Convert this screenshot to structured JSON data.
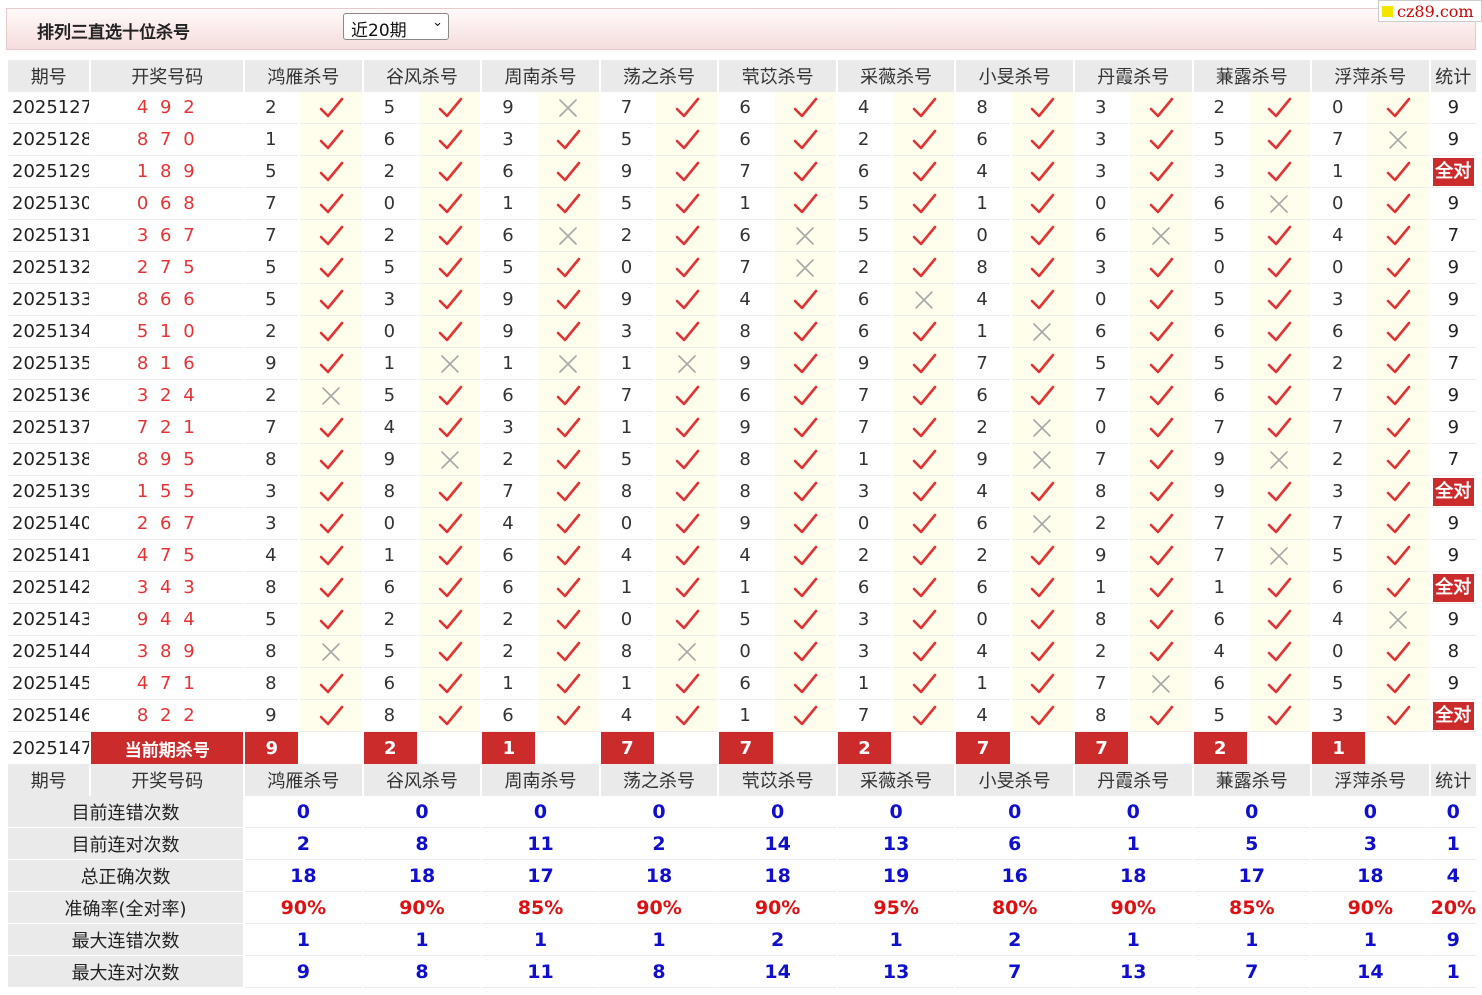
{
  "header": {
    "title": "排列三直选十位杀号",
    "period_select": "近20期",
    "logo_text": "cz89.com"
  },
  "columns": {
    "issue": "期号",
    "draw": "开奖号码",
    "experts": [
      "鸿雁杀号",
      "谷风杀号",
      "周南杀号",
      "荡之杀号",
      "茕苡杀号",
      "采薇杀号",
      "小旻杀号",
      "丹霞杀号",
      "蒹露杀号",
      "浮萍杀号"
    ],
    "stat": "统计"
  },
  "all_correct_label": "全对",
  "rows": [
    {
      "issue": "2025127",
      "draw": "4 9 2",
      "kills": [
        "2",
        "5",
        "9",
        "7",
        "6",
        "4",
        "8",
        "3",
        "2",
        "0"
      ],
      "ok": [
        1,
        1,
        0,
        1,
        1,
        1,
        1,
        1,
        1,
        1
      ],
      "stat": "9"
    },
    {
      "issue": "2025128",
      "draw": "8 7 0",
      "kills": [
        "1",
        "6",
        "3",
        "5",
        "6",
        "2",
        "6",
        "3",
        "5",
        "7"
      ],
      "ok": [
        1,
        1,
        1,
        1,
        1,
        1,
        1,
        1,
        1,
        0
      ],
      "stat": "9"
    },
    {
      "issue": "2025129",
      "draw": "1 8 9",
      "kills": [
        "5",
        "2",
        "6",
        "9",
        "7",
        "6",
        "4",
        "3",
        "3",
        "1"
      ],
      "ok": [
        1,
        1,
        1,
        1,
        1,
        1,
        1,
        1,
        1,
        1
      ],
      "stat": "全对"
    },
    {
      "issue": "2025130",
      "draw": "0 6 8",
      "kills": [
        "7",
        "0",
        "1",
        "5",
        "1",
        "5",
        "1",
        "0",
        "6",
        "0"
      ],
      "ok": [
        1,
        1,
        1,
        1,
        1,
        1,
        1,
        1,
        0,
        1
      ],
      "stat": "9"
    },
    {
      "issue": "2025131",
      "draw": "3 6 7",
      "kills": [
        "7",
        "2",
        "6",
        "2",
        "6",
        "5",
        "0",
        "6",
        "5",
        "4"
      ],
      "ok": [
        1,
        1,
        0,
        1,
        0,
        1,
        1,
        0,
        1,
        1
      ],
      "stat": "7"
    },
    {
      "issue": "2025132",
      "draw": "2 7 5",
      "kills": [
        "5",
        "5",
        "5",
        "0",
        "7",
        "2",
        "8",
        "3",
        "0",
        "0"
      ],
      "ok": [
        1,
        1,
        1,
        1,
        0,
        1,
        1,
        1,
        1,
        1
      ],
      "stat": "9"
    },
    {
      "issue": "2025133",
      "draw": "8 6 6",
      "kills": [
        "5",
        "3",
        "9",
        "9",
        "4",
        "6",
        "4",
        "0",
        "5",
        "3"
      ],
      "ok": [
        1,
        1,
        1,
        1,
        1,
        0,
        1,
        1,
        1,
        1
      ],
      "stat": "9"
    },
    {
      "issue": "2025134",
      "draw": "5 1 0",
      "kills": [
        "2",
        "0",
        "9",
        "3",
        "8",
        "6",
        "1",
        "6",
        "6",
        "6"
      ],
      "ok": [
        1,
        1,
        1,
        1,
        1,
        1,
        0,
        1,
        1,
        1
      ],
      "stat": "9"
    },
    {
      "issue": "2025135",
      "draw": "8 1 6",
      "kills": [
        "9",
        "1",
        "1",
        "1",
        "9",
        "9",
        "7",
        "5",
        "5",
        "2"
      ],
      "ok": [
        1,
        0,
        0,
        0,
        1,
        1,
        1,
        1,
        1,
        1
      ],
      "stat": "7"
    },
    {
      "issue": "2025136",
      "draw": "3 2 4",
      "kills": [
        "2",
        "5",
        "6",
        "7",
        "6",
        "7",
        "6",
        "7",
        "6",
        "7"
      ],
      "ok": [
        0,
        1,
        1,
        1,
        1,
        1,
        1,
        1,
        1,
        1
      ],
      "stat": "9"
    },
    {
      "issue": "2025137",
      "draw": "7 2 1",
      "kills": [
        "7",
        "4",
        "3",
        "1",
        "9",
        "7",
        "2",
        "0",
        "7",
        "7"
      ],
      "ok": [
        1,
        1,
        1,
        1,
        1,
        1,
        0,
        1,
        1,
        1
      ],
      "stat": "9"
    },
    {
      "issue": "2025138",
      "draw": "8 9 5",
      "kills": [
        "8",
        "9",
        "2",
        "5",
        "8",
        "1",
        "9",
        "7",
        "9",
        "2"
      ],
      "ok": [
        1,
        0,
        1,
        1,
        1,
        1,
        0,
        1,
        0,
        1
      ],
      "stat": "7"
    },
    {
      "issue": "2025139",
      "draw": "1 5 5",
      "kills": [
        "3",
        "8",
        "7",
        "8",
        "8",
        "3",
        "4",
        "8",
        "9",
        "3"
      ],
      "ok": [
        1,
        1,
        1,
        1,
        1,
        1,
        1,
        1,
        1,
        1
      ],
      "stat": "全对"
    },
    {
      "issue": "2025140",
      "draw": "2 6 7",
      "kills": [
        "3",
        "0",
        "4",
        "0",
        "9",
        "0",
        "6",
        "2",
        "7",
        "7"
      ],
      "ok": [
        1,
        1,
        1,
        1,
        1,
        1,
        0,
        1,
        1,
        1
      ],
      "stat": "9"
    },
    {
      "issue": "2025141",
      "draw": "4 7 5",
      "kills": [
        "4",
        "1",
        "6",
        "4",
        "4",
        "2",
        "2",
        "9",
        "7",
        "5"
      ],
      "ok": [
        1,
        1,
        1,
        1,
        1,
        1,
        1,
        1,
        0,
        1
      ],
      "stat": "9"
    },
    {
      "issue": "2025142",
      "draw": "3 4 3",
      "kills": [
        "8",
        "6",
        "6",
        "1",
        "1",
        "6",
        "6",
        "1",
        "1",
        "6"
      ],
      "ok": [
        1,
        1,
        1,
        1,
        1,
        1,
        1,
        1,
        1,
        1
      ],
      "stat": "全对"
    },
    {
      "issue": "2025143",
      "draw": "9 4 4",
      "kills": [
        "5",
        "2",
        "2",
        "0",
        "5",
        "3",
        "0",
        "8",
        "6",
        "4"
      ],
      "ok": [
        1,
        1,
        1,
        1,
        1,
        1,
        1,
        1,
        1,
        0
      ],
      "stat": "9"
    },
    {
      "issue": "2025144",
      "draw": "3 8 9",
      "kills": [
        "8",
        "5",
        "2",
        "8",
        "0",
        "3",
        "4",
        "2",
        "4",
        "0"
      ],
      "ok": [
        0,
        1,
        1,
        0,
        1,
        1,
        1,
        1,
        1,
        1
      ],
      "stat": "8"
    },
    {
      "issue": "2025145",
      "draw": "4 7 1",
      "kills": [
        "8",
        "6",
        "1",
        "1",
        "6",
        "1",
        "1",
        "7",
        "6",
        "5"
      ],
      "ok": [
        1,
        1,
        1,
        1,
        1,
        1,
        1,
        0,
        1,
        1
      ],
      "stat": "9"
    },
    {
      "issue": "2025146",
      "draw": "8 2 2",
      "kills": [
        "9",
        "8",
        "6",
        "4",
        "1",
        "7",
        "4",
        "8",
        "5",
        "3"
      ],
      "ok": [
        1,
        1,
        1,
        1,
        1,
        1,
        1,
        1,
        1,
        1
      ],
      "stat": "全对"
    }
  ],
  "current": {
    "issue": "2025147",
    "label": "当前期杀号",
    "kills": [
      "9",
      "2",
      "1",
      "7",
      "7",
      "2",
      "7",
      "7",
      "2",
      "1"
    ]
  },
  "summary": [
    {
      "label": "目前连错次数",
      "values": [
        "0",
        "0",
        "0",
        "0",
        "0",
        "0",
        "0",
        "0",
        "0",
        "0"
      ],
      "stat": "0",
      "style": "val"
    },
    {
      "label": "目前连对次数",
      "values": [
        "2",
        "8",
        "11",
        "2",
        "14",
        "13",
        "6",
        "1",
        "5",
        "3"
      ],
      "stat": "1",
      "style": "val"
    },
    {
      "label": "总正确次数",
      "values": [
        "18",
        "18",
        "17",
        "18",
        "18",
        "19",
        "16",
        "18",
        "17",
        "18"
      ],
      "stat": "4",
      "style": "val"
    },
    {
      "label": "准确率(全对率)",
      "values": [
        "90%",
        "90%",
        "85%",
        "90%",
        "90%",
        "95%",
        "80%",
        "90%",
        "85%",
        "90%"
      ],
      "stat": "20%",
      "style": "rate"
    },
    {
      "label": "最大连错次数",
      "values": [
        "1",
        "1",
        "1",
        "1",
        "2",
        "1",
        "2",
        "1",
        "1",
        "1"
      ],
      "stat": "9",
      "style": "val"
    },
    {
      "label": "最大连对次数",
      "values": [
        "9",
        "8",
        "11",
        "8",
        "14",
        "13",
        "7",
        "13",
        "7",
        "14"
      ],
      "stat": "1",
      "style": "val"
    }
  ]
}
